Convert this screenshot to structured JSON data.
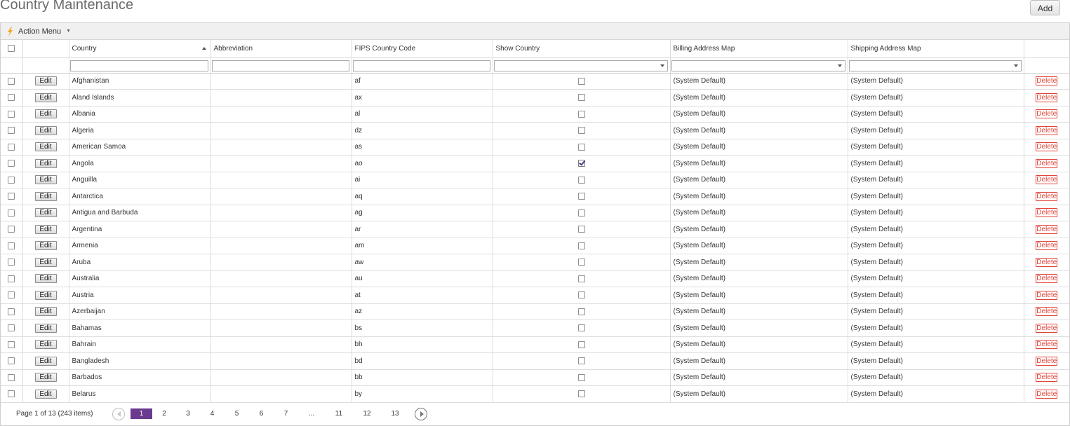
{
  "page_title": "Country Maintenance",
  "add_label": "Add",
  "toolbar": {
    "action_menu_label": "Action Menu"
  },
  "columns": {
    "country": "Country",
    "abbreviation": "Abbreviation",
    "fips": "FIPS Country Code",
    "show": "Show Country",
    "billing": "Billing Address Map",
    "shipping": "Shipping Address Map"
  },
  "edit_label": "Edit",
  "delete_label": "Delete",
  "rows": [
    {
      "country": "Afghanistan",
      "abbr": "",
      "fips": "af",
      "show": false,
      "billing": "(System Default)",
      "shipping": "(System Default)"
    },
    {
      "country": "Aland Islands",
      "abbr": "",
      "fips": "ax",
      "show": false,
      "billing": "(System Default)",
      "shipping": "(System Default)"
    },
    {
      "country": "Albania",
      "abbr": "",
      "fips": "al",
      "show": false,
      "billing": "(System Default)",
      "shipping": "(System Default)"
    },
    {
      "country": "Algeria",
      "abbr": "",
      "fips": "dz",
      "show": false,
      "billing": "(System Default)",
      "shipping": "(System Default)"
    },
    {
      "country": "American Samoa",
      "abbr": "",
      "fips": "as",
      "show": false,
      "billing": "(System Default)",
      "shipping": "(System Default)"
    },
    {
      "country": "Angola",
      "abbr": "",
      "fips": "ao",
      "show": true,
      "billing": "(System Default)",
      "shipping": "(System Default)"
    },
    {
      "country": "Anguilla",
      "abbr": "",
      "fips": "ai",
      "show": false,
      "billing": "(System Default)",
      "shipping": "(System Default)"
    },
    {
      "country": "Antarctica",
      "abbr": "",
      "fips": "aq",
      "show": false,
      "billing": "(System Default)",
      "shipping": "(System Default)"
    },
    {
      "country": "Antigua and Barbuda",
      "abbr": "",
      "fips": "ag",
      "show": false,
      "billing": "(System Default)",
      "shipping": "(System Default)"
    },
    {
      "country": "Argentina",
      "abbr": "",
      "fips": "ar",
      "show": false,
      "billing": "(System Default)",
      "shipping": "(System Default)"
    },
    {
      "country": "Armenia",
      "abbr": "",
      "fips": "am",
      "show": false,
      "billing": "(System Default)",
      "shipping": "(System Default)"
    },
    {
      "country": "Aruba",
      "abbr": "",
      "fips": "aw",
      "show": false,
      "billing": "(System Default)",
      "shipping": "(System Default)"
    },
    {
      "country": "Australia",
      "abbr": "",
      "fips": "au",
      "show": false,
      "billing": "(System Default)",
      "shipping": "(System Default)"
    },
    {
      "country": "Austria",
      "abbr": "",
      "fips": "at",
      "show": false,
      "billing": "(System Default)",
      "shipping": "(System Default)"
    },
    {
      "country": "Azerbaijan",
      "abbr": "",
      "fips": "az",
      "show": false,
      "billing": "(System Default)",
      "shipping": "(System Default)"
    },
    {
      "country": "Bahamas",
      "abbr": "",
      "fips": "bs",
      "show": false,
      "billing": "(System Default)",
      "shipping": "(System Default)"
    },
    {
      "country": "Bahrain",
      "abbr": "",
      "fips": "bh",
      "show": false,
      "billing": "(System Default)",
      "shipping": "(System Default)"
    },
    {
      "country": "Bangladesh",
      "abbr": "",
      "fips": "bd",
      "show": false,
      "billing": "(System Default)",
      "shipping": "(System Default)"
    },
    {
      "country": "Barbados",
      "abbr": "",
      "fips": "bb",
      "show": false,
      "billing": "(System Default)",
      "shipping": "(System Default)"
    },
    {
      "country": "Belarus",
      "abbr": "",
      "fips": "by",
      "show": false,
      "billing": "(System Default)",
      "shipping": "(System Default)"
    }
  ],
  "pager": {
    "info": "Page 1 of 13 (243 items)",
    "pages": [
      "1",
      "2",
      "3",
      "4",
      "5",
      "6",
      "7",
      "...",
      "11",
      "12",
      "13"
    ],
    "current": "1"
  },
  "colors": {
    "accent": "#6a3a8e",
    "delete": "#e0443a",
    "toolbar_icon": "#f5a623"
  }
}
